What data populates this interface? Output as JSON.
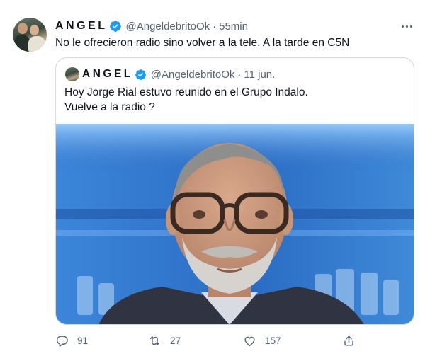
{
  "tweet": {
    "author_name": "ANGEL",
    "handle": "@AngeldebritoOk",
    "separator": "·",
    "time": "55min",
    "text": "No le ofrecieron radio sino volver a la tele. A la tarde en C5N"
  },
  "quote": {
    "author_name": "ANGEL",
    "handle": "@AngeldebritoOk",
    "separator": "·",
    "date": "11 jun.",
    "text_line1": "Hoy Jorge Rial estuvo reunido en el Grupo Indalo.",
    "text_line2": "Vuelve a la radio ?"
  },
  "actions": {
    "replies": "91",
    "retweets": "27",
    "likes": "157"
  },
  "colors": {
    "text_primary": "#0f1419",
    "text_secondary": "#536471",
    "verified": "#1d9bf0",
    "border": "#cfd9de"
  },
  "icons": [
    "verified-badge-icon",
    "more-options-icon",
    "reply-icon",
    "retweet-icon",
    "like-icon",
    "share-icon"
  ]
}
